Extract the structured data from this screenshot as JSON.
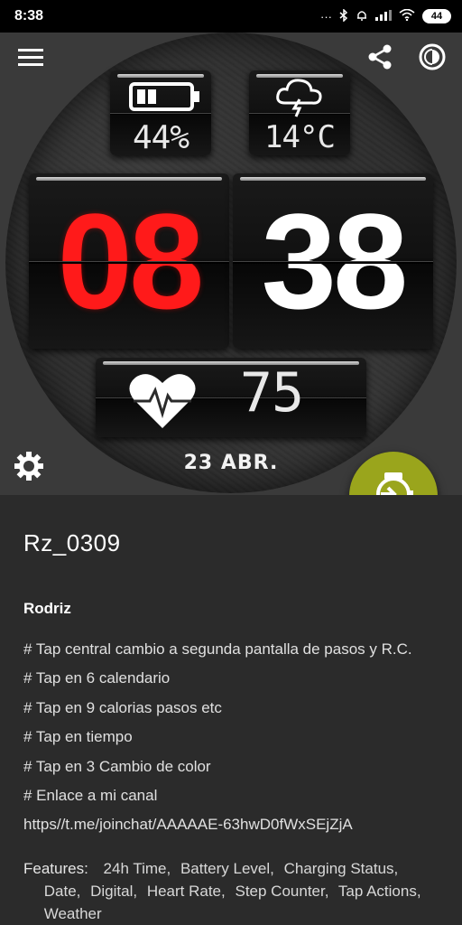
{
  "status_bar": {
    "time": "8:38",
    "indicators": "···",
    "battery": "44",
    "icons": [
      "bluetooth-icon",
      "alarm-icon",
      "signal-icon",
      "wifi-icon",
      "battery-icon"
    ]
  },
  "toolbar": {
    "icons": [
      "menu-icon",
      "share-icon",
      "theme-icon"
    ]
  },
  "watch_face": {
    "battery_percent": "44%",
    "temperature": "14°C",
    "hours": "08",
    "minutes": "38",
    "heart_rate": "75",
    "date": "23 ABR.",
    "colors": {
      "hours": "#ff1a1a",
      "minutes": "#ffffff",
      "fab": "#9aa51c"
    }
  },
  "details": {
    "title": "Rz_0309",
    "author": "Rodriz",
    "lines": [
      "# Tap central cambio a segunda pantalla de pasos y R.C.",
      "# Tap en 6 calendario",
      "# Tap en 9 calorias pasos etc",
      "# Tap en tiempo",
      "# Tap en 3 Cambio de color",
      "# Enlace a mi canal",
      "https//t.me/joinchat/AAAAAE-63hwD0fWxSEjZjA"
    ],
    "features_label": "Features:",
    "features": [
      "24h Time,",
      "Battery Level,",
      "Charging Status,",
      "Date,",
      "Digital,",
      "Heart Rate,",
      "Step Counter,",
      "Tap Actions,",
      "Weather"
    ]
  }
}
